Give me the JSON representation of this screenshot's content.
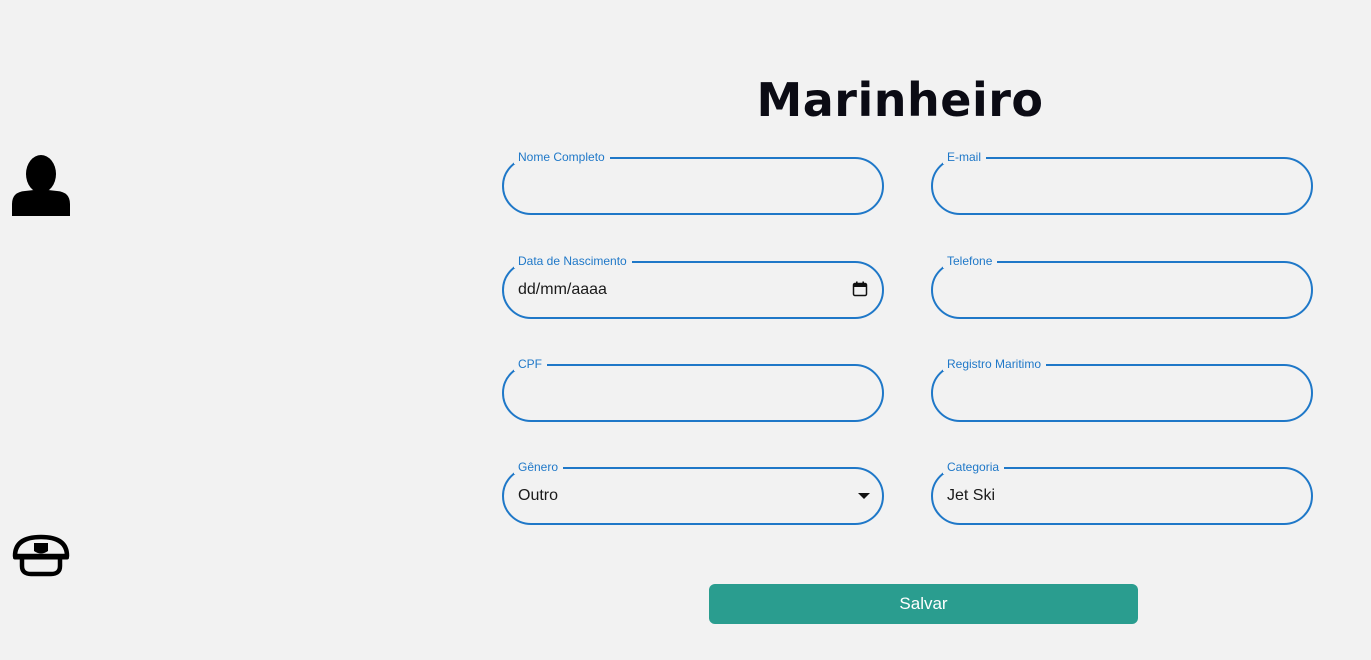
{
  "sidebar": {
    "items": [
      {
        "icon": "user-icon"
      },
      {
        "icon": "sailor-cap-icon"
      }
    ]
  },
  "form": {
    "title": "Marinheiro",
    "fields": {
      "nome": {
        "label": "Nome Completo",
        "value": ""
      },
      "email": {
        "label": "E-mail",
        "value": ""
      },
      "nascimento": {
        "label": "Data de Nascimento",
        "placeholder": "dd/mm/aaaa"
      },
      "telefone": {
        "label": "Telefone",
        "value": ""
      },
      "cpf": {
        "label": "CPF",
        "value": ""
      },
      "registro": {
        "label": "Registro Maritimo",
        "value": ""
      },
      "genero": {
        "label": "Gênero",
        "value": "Outro"
      },
      "categoria": {
        "label": "Categoria",
        "value": "Jet Ski"
      }
    },
    "save_label": "Salvar"
  },
  "colors": {
    "background": "#f2f2f2",
    "accent": "#1f78c8",
    "button": "#2a9d8f"
  }
}
